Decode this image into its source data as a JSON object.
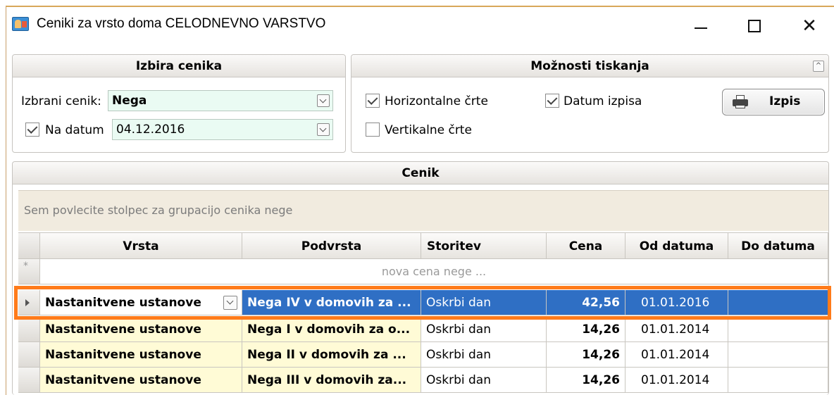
{
  "window": {
    "title": "Ceniki za vrsto doma CELODNEVNO VARSTVO",
    "close_symbol": "✕"
  },
  "selection": {
    "header": "Izbira cenika",
    "selected_label": "Izbrani cenik:",
    "selected_value": "Nega",
    "date_label": "Na datum",
    "date_checked": true,
    "date_value": "04.12.2016"
  },
  "print_options": {
    "header": "Možnosti tiskanja",
    "horizontal_lines": {
      "label": "Horizontalne črte",
      "checked": true
    },
    "vertical_lines": {
      "label": "Vertikalne črte",
      "checked": false
    },
    "print_date": {
      "label": "Datum izpisa",
      "checked": true
    },
    "print_button": "Izpis"
  },
  "cenik": {
    "header": "Cenik",
    "group_hint": "Sem povlecite stolpec za grupacijo cenika nege",
    "new_row_text": "nova cena nege ...",
    "new_row_marker": "*",
    "columns": [
      "Vrsta",
      "Podvrsta",
      "Storitev",
      "Cena",
      "Od datuma",
      "Do datuma"
    ],
    "rows": [
      {
        "vrsta": "Nastanitvene ustanove",
        "podvrsta": "Nega IV  v domovih za ...",
        "storitev": "Oskrbi dan",
        "cena": "42,56",
        "od": "01.01.2016",
        "do": "",
        "selected": true
      },
      {
        "vrsta": "Nastanitvene ustanove",
        "podvrsta": "Nega I  v domovih za o...",
        "storitev": "Oskrbi dan",
        "cena": "14,26",
        "od": "01.01.2014",
        "do": ""
      },
      {
        "vrsta": "Nastanitvene ustanove",
        "podvrsta": "Nega II  v domovih za ...",
        "storitev": "Oskrbi dan",
        "cena": "14,26",
        "od": "01.01.2014",
        "do": ""
      },
      {
        "vrsta": "Nastanitvene ustanove",
        "podvrsta": "Nega III  v domovih za...",
        "storitev": "Oskrbi dan",
        "cena": "14,26",
        "od": "01.01.2014",
        "do": ""
      }
    ]
  },
  "colors": {
    "selection_blue": "#2f6fc4",
    "highlight_orange": "#ff7b1a",
    "row_yellow": "#fffbd6",
    "combo_green": "#eafbf3"
  }
}
